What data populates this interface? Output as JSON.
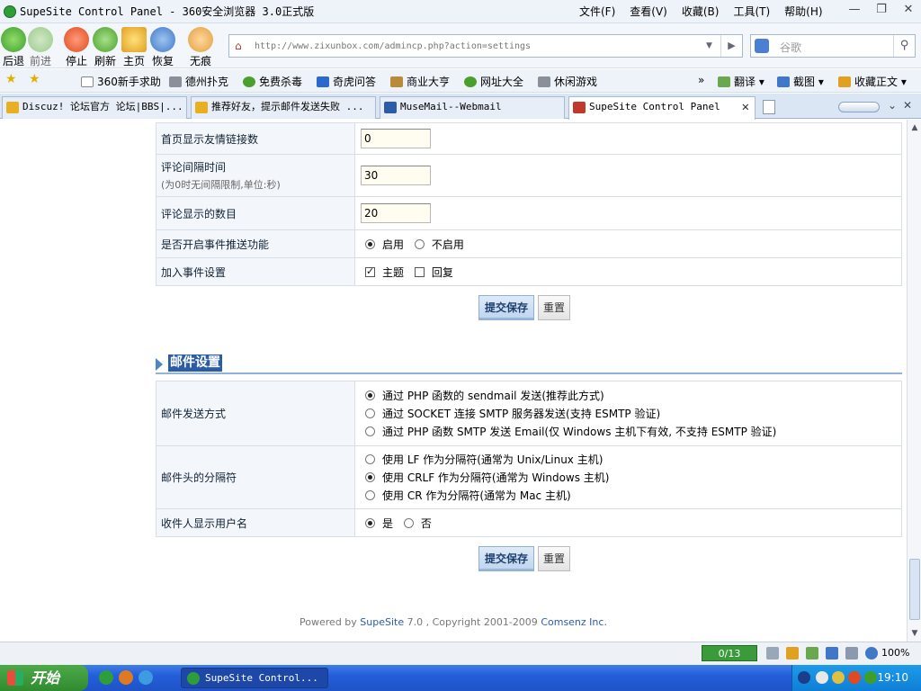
{
  "window": {
    "title": "SupeSite Control Panel - 360安全浏览器 3.0正式版",
    "menus": [
      "文件(F)",
      "查看(V)",
      "收藏(B)",
      "工具(T)",
      "帮助(H)"
    ]
  },
  "nav": {
    "back": "后退",
    "forward": "前进",
    "stop": "停止",
    "refresh": "刷新",
    "home": "主页",
    "restore": "恢复",
    "incognito": "无痕",
    "url": "http://www.zixunbox.com/admincp.php?action=settings",
    "search_placeholder": "谷歌"
  },
  "favorites": {
    "items": [
      "360新手求助",
      "德州扑克",
      "免费杀毒",
      "奇虎问答",
      "商业大亨",
      "网址大全",
      "休闲游戏"
    ],
    "more": "»",
    "translate": "翻译",
    "screenshot": "截图",
    "collect": "收藏正文"
  },
  "tabs": [
    {
      "label": "Discuz! 论坛官方 论坛|BBS|..."
    },
    {
      "label": "推荐好友，提示邮件发送失败 ..."
    },
    {
      "label": "MuseMail--Webmail"
    },
    {
      "label": "SupeSite Control Panel"
    }
  ],
  "form1": {
    "rows": {
      "friend_links": {
        "label": "首页显示友情链接数",
        "value": "0"
      },
      "comment_interval": {
        "label": "评论间隔时间",
        "sub": "(为0时无间隔限制,单位:秒)",
        "value": "30"
      },
      "comment_count": {
        "label": "评论显示的数目",
        "value": "20"
      },
      "event_push": {
        "label": "是否开启事件推送功能",
        "opt_on": "启用",
        "opt_off": "不启用",
        "selected": "启用"
      },
      "event_settings": {
        "label": "加入事件设置",
        "opt_topic": "主题",
        "opt_reply": "回复",
        "topic_checked": true,
        "reply_checked": false
      }
    },
    "submit": "提交保存",
    "reset": "重置"
  },
  "mail": {
    "title": "邮件设置",
    "send_method": {
      "label": "邮件发送方式",
      "options": [
        "通过 PHP 函数的 sendmail 发送(推荐此方式)",
        "通过 SOCKET 连接 SMTP 服务器发送(支持 ESMTP 验证)",
        "通过 PHP 函数 SMTP 发送 Email(仅 Windows 主机下有效, 不支持 ESMTP 验证)"
      ],
      "selected_index": 0
    },
    "separator": {
      "label": "邮件头的分隔符",
      "options": [
        "使用 LF 作为分隔符(通常为 Unix/Linux 主机)",
        "使用 CRLF 作为分隔符(通常为 Windows 主机)",
        "使用 CR 作为分隔符(通常为 Mac 主机)"
      ],
      "selected_index": 1
    },
    "show_username": {
      "label": "收件人显示用户名",
      "opt_yes": "是",
      "opt_no": "否",
      "selected": "是"
    },
    "submit": "提交保存",
    "reset": "重置"
  },
  "footer": {
    "prefix": "Powered by ",
    "product": "SupeSite",
    "version": " 7.0 , Copyright 2001-2009 ",
    "company": "Comsenz Inc."
  },
  "status": {
    "counter": "0/13",
    "zoom": "100%"
  },
  "taskbar": {
    "start": "开始",
    "item": "SupeSite Control...",
    "clock": "19:10"
  },
  "colors": {
    "section_header_bg": "#2a5ca8",
    "label_bg": "#f3f7fc",
    "taskbar_blue": "#245edb",
    "start_green": "#3a9b3a"
  }
}
